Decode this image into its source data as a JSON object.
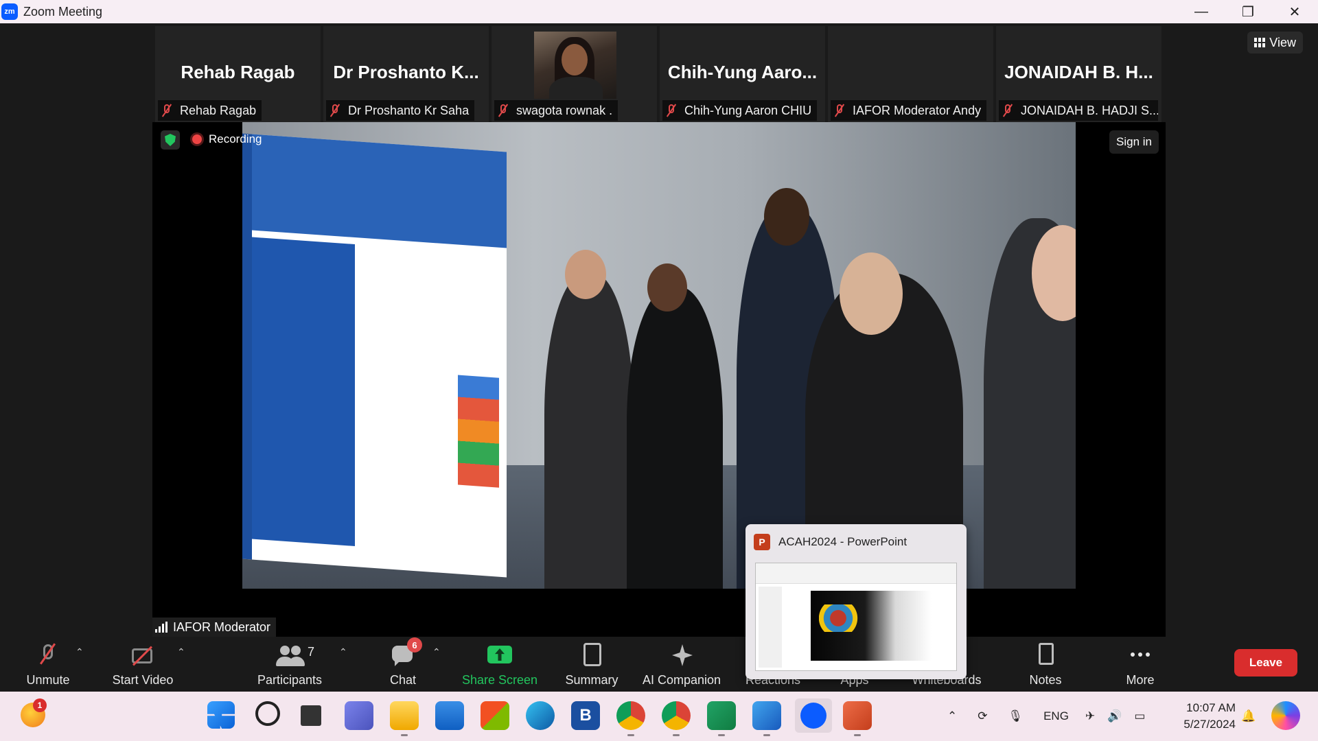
{
  "window": {
    "title": "Zoom Meeting",
    "logo_text": "zm",
    "controls": [
      "—",
      "❐",
      "✕"
    ]
  },
  "gallery": [
    {
      "big_name": "Rehab Ragab",
      "label": "Rehab Ragab",
      "muted": true,
      "has_video": false
    },
    {
      "big_name": "Dr Proshanto K...",
      "label": "Dr Proshanto Kr Saha",
      "muted": true,
      "has_video": false
    },
    {
      "big_name": "",
      "label": "swagota rownak .",
      "muted": true,
      "has_video": true
    },
    {
      "big_name": "Chih-Yung Aaro...",
      "label": "Chih-Yung Aaron CHIU",
      "muted": true,
      "has_video": false
    },
    {
      "big_name": "",
      "label": "IAFOR Moderator Andy",
      "muted": true,
      "has_video": false
    },
    {
      "big_name": "JONAIDAH B. H...",
      "label": "JONAIDAH B. HADJI S...",
      "muted": true,
      "has_video": false
    }
  ],
  "view_button": "View",
  "main_video": {
    "recording_label": "Recording",
    "sign_in": "Sign in",
    "speaker_name": "IAFOR Moderator"
  },
  "toolbar": {
    "unmute": "Unmute",
    "start_video": "Start Video",
    "participants": "Participants",
    "participants_count": "7",
    "chat": "Chat",
    "chat_badge": "6",
    "share_screen": "Share Screen",
    "summary": "Summary",
    "ai_companion": "AI Companion",
    "reactions": "Reactions",
    "apps": "Apps",
    "whiteboards": "Whiteboards",
    "notes": "Notes",
    "more": "More",
    "leave": "Leave",
    "share_color": "#22c55e",
    "leave_color": "#d92d2d"
  },
  "popup": {
    "title": "ACAH2024 - PowerPoint",
    "icon_letter": "P"
  },
  "taskbar": {
    "notification_badge": "1",
    "language": "ENG",
    "time": "10:07 AM",
    "date": "5/27/2024",
    "apps": [
      "windows-start",
      "search",
      "task-view",
      "teams",
      "file-explorer",
      "mail",
      "store",
      "edge",
      "b-app",
      "chrome",
      "chrome-profile",
      "excel",
      "word",
      "zoom",
      "powerpoint"
    ]
  }
}
